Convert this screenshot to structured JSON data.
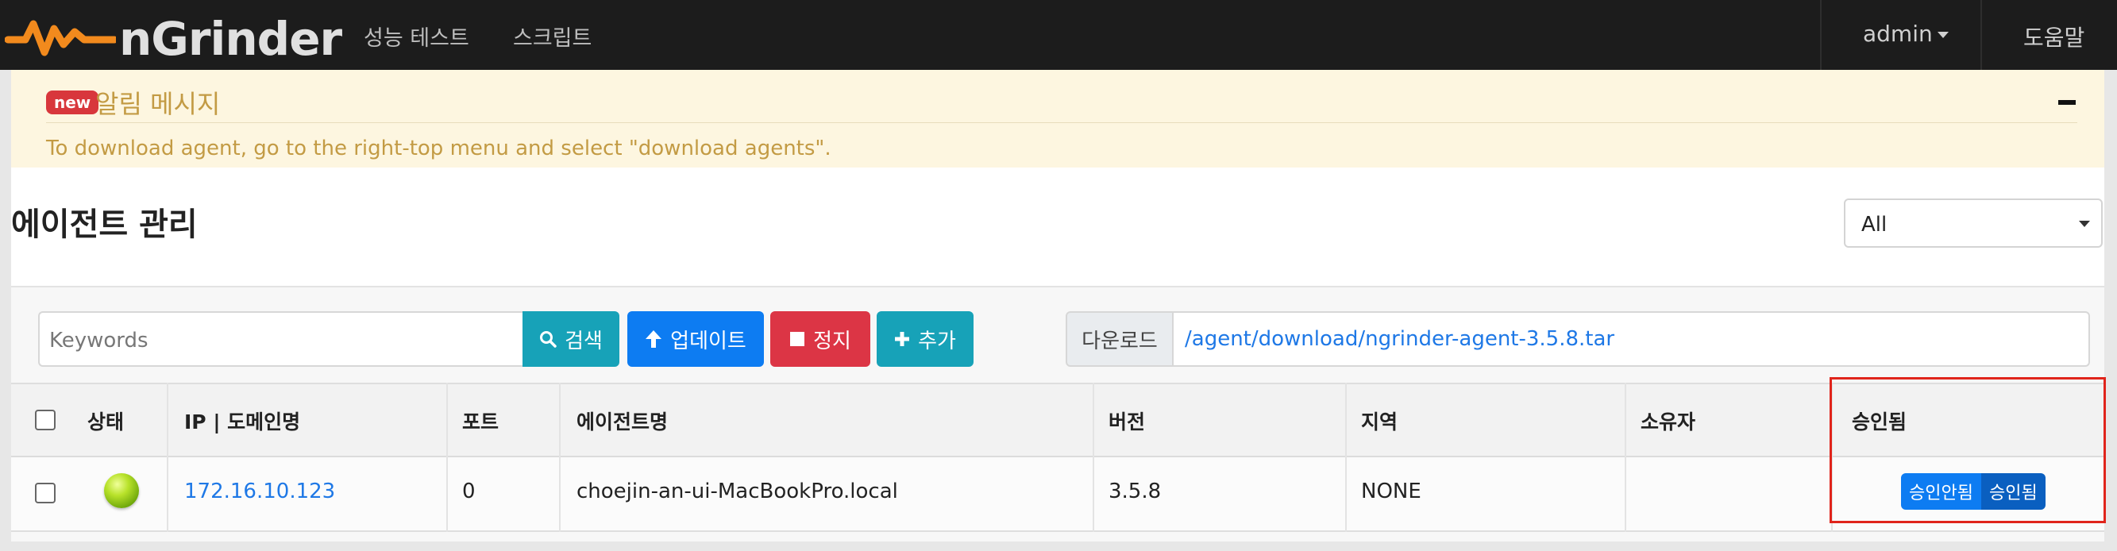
{
  "navbar": {
    "brand": "nGrinder",
    "menu": [
      "성능 테스트",
      "스크립트"
    ],
    "user": "admin",
    "help": "도움말"
  },
  "alert": {
    "badge": "new",
    "title": "알림 메시지",
    "message": "To download agent, go to the right-top menu and select \"download agents\"."
  },
  "page": {
    "title": "에이전트 관리",
    "filter": {
      "selected": "All"
    }
  },
  "toolbar": {
    "search_placeholder": "Keywords",
    "search_label": "검색",
    "update_label": "업데이트",
    "stop_label": "정지",
    "add_label": "추가",
    "download_label": "다운로드",
    "download_path": "/agent/download/ngrinder-agent-3.5.8.tar"
  },
  "table": {
    "columns": [
      "상태",
      "IP | 도메인명",
      "포트",
      "에이전트명",
      "버전",
      "지역",
      "소유자",
      "승인됨"
    ],
    "rows": [
      {
        "ip": "172.16.10.123",
        "port": "0",
        "name": "choejin-an-ui-MacBookPro.local",
        "version": "3.5.8",
        "region": "NONE",
        "owner": "",
        "approve_off": "승인안됨",
        "approve_on": "승인됨"
      }
    ]
  },
  "colors": {
    "navbar": "#1c1c1c",
    "alert_bg": "#fdf6e0",
    "alert_text": "#c39b44",
    "primary": "#0d7cf2",
    "info": "#17a2b8",
    "danger": "#dc3545",
    "highlight": "#e0241b"
  }
}
